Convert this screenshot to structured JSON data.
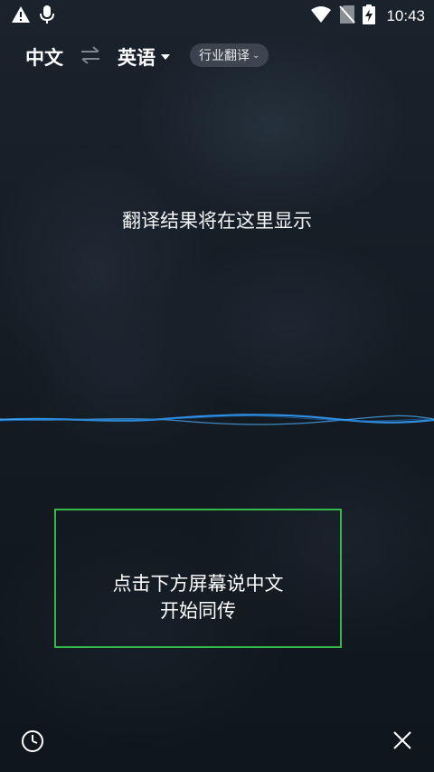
{
  "status_bar": {
    "time": "10:43",
    "icons": [
      "warning-icon",
      "microphone-icon",
      "wifi-icon",
      "no-sim-icon",
      "battery-charging-icon"
    ]
  },
  "header": {
    "source_language": "中文",
    "swap_icon": "swap-arrows-icon",
    "target_language": "英语",
    "industry_label": "行业翻译"
  },
  "main": {
    "result_placeholder": "翻译结果将在这里显示"
  },
  "mic_prompt": {
    "line1": "点击下方屏幕说中文",
    "line2": "开始同传"
  },
  "footer": {
    "history_icon": "clock-icon",
    "close_icon": "close-icon"
  },
  "colors": {
    "background": "#141a22",
    "wave": "#2f8fe0",
    "mic_box_border": "#36b84a",
    "chip_bg": "#4a535c"
  }
}
